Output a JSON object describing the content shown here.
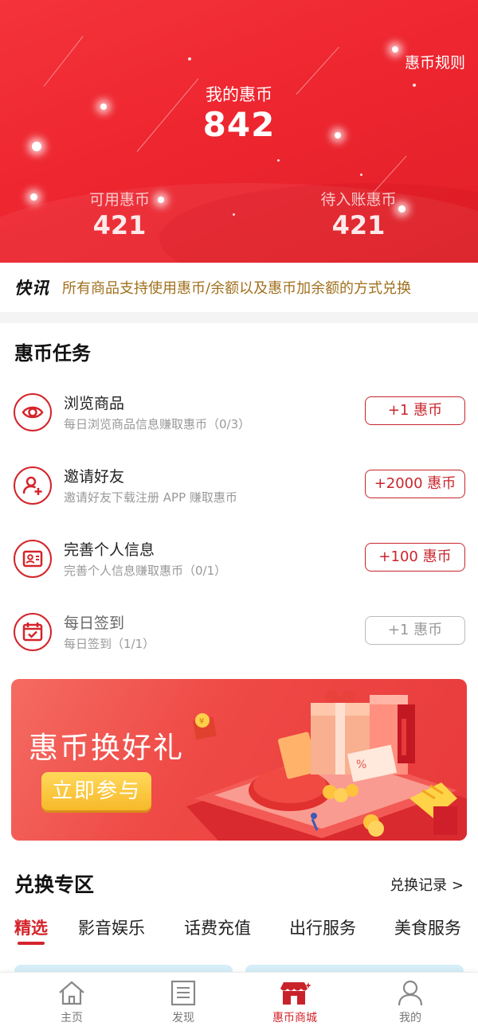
{
  "header": {
    "rules_link": "惠币规则",
    "total_label": "我的惠币",
    "total_value": "842",
    "available_label": "可用惠币",
    "available_value": "421",
    "pending_label": "待入账惠币",
    "pending_value": "421"
  },
  "news": {
    "tag": "快讯",
    "text": "所有商品支持使用惠币/余额以及惠币加余额的方式兑换"
  },
  "tasks": {
    "title": "惠币任务",
    "items": [
      {
        "name": "浏览商品",
        "desc": "每日浏览商品信息赚取惠币（0/3）",
        "reward": "+1 惠币",
        "icon": "eye-icon",
        "done": false
      },
      {
        "name": "邀请好友",
        "desc": "邀请好友下载注册 APP 赚取惠币",
        "reward": "+2000 惠币",
        "icon": "add-user-icon",
        "done": false
      },
      {
        "name": "完善个人信息",
        "desc": "完善个人信息赚取惠币（0/1）",
        "reward": "+100 惠币",
        "icon": "id-card-icon",
        "done": false
      },
      {
        "name": "每日签到",
        "desc": "每日签到（1/1）",
        "reward": "+1 惠币",
        "icon": "calendar-check-icon",
        "done": true
      }
    ]
  },
  "banner": {
    "title": "惠币换好礼",
    "button": "立即参与"
  },
  "exchange": {
    "title": "兑换专区",
    "records_link": "兑换记录 >",
    "categories": [
      "精选",
      "影音娱乐",
      "话费充值",
      "出行服务",
      "美食服务"
    ],
    "active_category": "精选"
  },
  "tabbar": {
    "items": [
      {
        "label": "主页",
        "icon": "home-icon"
      },
      {
        "label": "发现",
        "icon": "document-icon"
      },
      {
        "label": "惠币商城",
        "icon": "store-icon"
      },
      {
        "label": "我的",
        "icon": "user-icon"
      }
    ],
    "active": "惠币商城"
  },
  "colors": {
    "brand_red": "#e21f28",
    "accent_red": "#d4242b",
    "news_text": "#a0701d",
    "button_yellow": "#f7b92b"
  }
}
